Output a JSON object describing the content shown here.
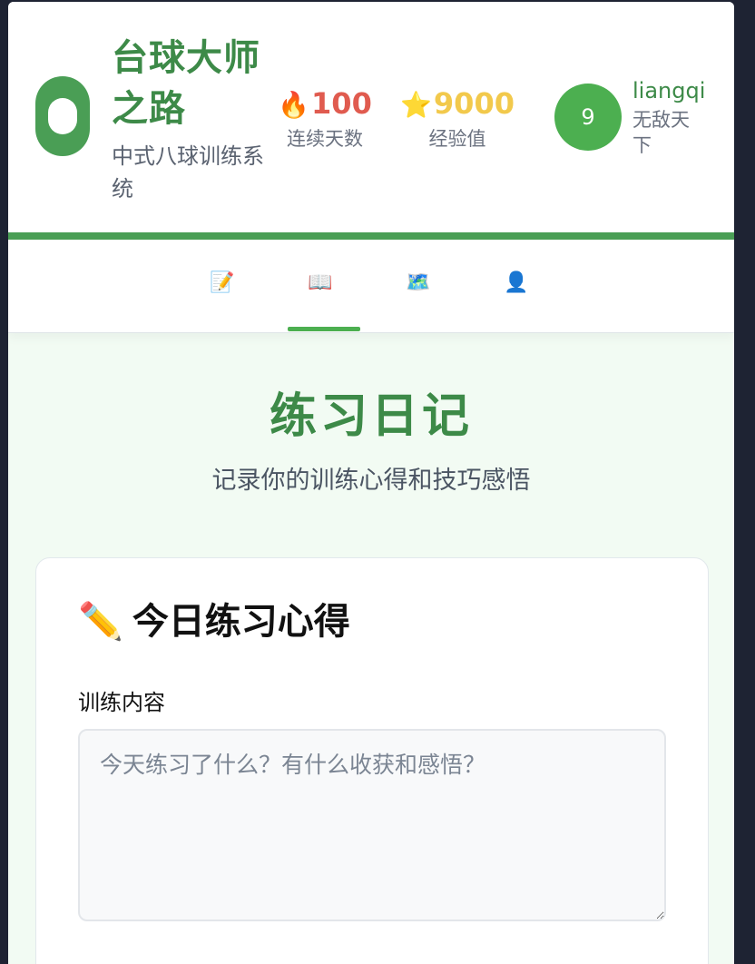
{
  "header": {
    "title": "台球大师之路",
    "subtitle": "中式八球训练系统",
    "streak": {
      "icon": "flame-icon",
      "value": "100",
      "label": "连续天数"
    },
    "xp": {
      "icon": "star-icon",
      "value": "9000",
      "label": "经验值"
    },
    "user": {
      "level": "9",
      "name": "liangqi",
      "rank": "无敌天下"
    }
  },
  "tabs": [
    {
      "icon": "memo-icon",
      "glyph": "📝",
      "active": false
    },
    {
      "icon": "open-book-icon",
      "glyph": "📖",
      "active": true
    },
    {
      "icon": "world-map-icon",
      "glyph": "🗺️",
      "active": false
    },
    {
      "icon": "user-silhouette-icon",
      "glyph": "👤",
      "active": false
    }
  ],
  "main": {
    "title": "练习日记",
    "subtitle": "记录你的训练心得和技巧感悟",
    "card": {
      "icon": "✏️",
      "title": "今日练习心得",
      "field_label": "训练内容",
      "field_placeholder": "今天练习了什么？有什么收获和感悟？",
      "field_value": ""
    }
  },
  "colors": {
    "accent": "#4a9e55",
    "title_green": "#3d8a48",
    "streak_red": "#e05b4f",
    "xp_gold": "#f2c94c",
    "page_bg": "#f2fbf3"
  }
}
